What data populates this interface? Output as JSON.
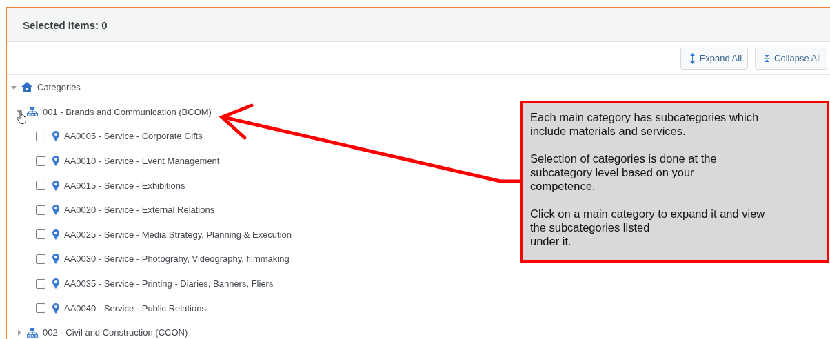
{
  "header": {
    "title": "Selected Items: 0"
  },
  "toolbar": {
    "buttons": [
      {
        "kind": "expand",
        "label": "Expand All"
      },
      {
        "kind": "collapse",
        "label": "Collapse All"
      }
    ]
  },
  "tree": {
    "label": "Categories",
    "expanded": true,
    "children": [
      {
        "label": "001 - Brands and Communication (BCOM)",
        "expanded": true,
        "children": [
          {
            "label": "AA0005 - Service - Corporate Gifts",
            "checked": false
          },
          {
            "label": "AA0010 - Service - Event Management",
            "checked": false
          },
          {
            "label": "AA0015 - Service - Exhibitions",
            "checked": false
          },
          {
            "label": "AA0020 - Service - External Relations",
            "checked": false
          },
          {
            "label": "AA0025 - Service - Media Strategy, Planning & Execution",
            "checked": false
          },
          {
            "label": "AA0030 - Service - Photograhy, Videography, filmmaking",
            "checked": false
          },
          {
            "label": "AA0035 - Service - Printing - Diaries, Banners, Fliers",
            "checked": false
          },
          {
            "label": "AA0040 - Service - Public Relations",
            "checked": false
          }
        ]
      },
      {
        "label": "002 - Civil and Construction (CCON)",
        "expanded": false
      }
    ]
  },
  "callout": {
    "paragraphs": [
      "Each main category has subcategories which\ninclude materials and services.",
      "Selection of categories is done at the\nsubcategory level based on your\ncompetence.",
      "Click on a main category to expand it and view\nthe subcategories listed\nunder it."
    ]
  }
}
